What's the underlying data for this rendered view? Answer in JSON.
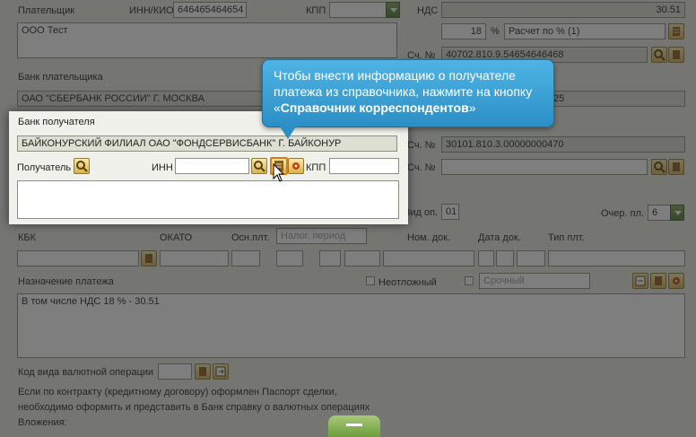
{
  "payer": {
    "label": "Плательщик",
    "inn_label": "ИНН/КИО",
    "inn_value": "646465464654",
    "kpp_label": "КПП",
    "kpp_value": "",
    "name_value": "ООО Тест",
    "bank_label": "Банк плательщика",
    "bank_value": "ОАО \"СБЕРБАНК РОССИИ\" Г. МОСКВА",
    "account_label": "Сч. №",
    "account_value": "40702.810.9.54654646468"
  },
  "vat": {
    "label": "НДС",
    "value": "30.51",
    "rate": "18",
    "percent_sign": "%",
    "calc_value": "Расчет по % (1)"
  },
  "recipient": {
    "bank_label": "Банк получателя",
    "bank_value": "БАЙКОНУРСКИЙ ФИЛИАЛ ОАО \"ФОНДСЕРВИСБАНК\" Г. БАЙКОНУР",
    "label": "Получатель",
    "inn_label": "ИНН",
    "inn_value": "",
    "kpp_label": "КПП",
    "kpp_value": "",
    "name_value": "",
    "corr_label": "Сч. №",
    "corr_value": "30101.810.3.00000000470",
    "account_label": "Сч. №",
    "account_value": "",
    "hidden_suffix": "25"
  },
  "operation": {
    "vid_label": "Вид оп.",
    "vid_value": "01",
    "queue_label": "Очер. пл.",
    "queue_value": "6"
  },
  "tax": {
    "kbk_label": "КБК",
    "okato_label": "ОКАТО",
    "osn_label": "Осн.плт.",
    "period_placeholder": "Налог. период",
    "nom_label": "Ном. док.",
    "date_label": "Дата док.",
    "type_label": "Тип плт."
  },
  "purpose": {
    "label": "Назначение платежа",
    "urgent_label": "Неотложный",
    "urgent_field": "Срочный",
    "text": "В том числе НДС 18 % - 30.51"
  },
  "currency": {
    "label": "Код вида валютной операции",
    "note_line1": "Если по контракту (кредитному договору) оформлен Паспорт сделки,",
    "note_line2": "необходимо оформить и представить в Банк справку о валютных операциях",
    "attachments_label": "Вложения:"
  },
  "tooltip": {
    "text": "Чтобы внести информацию о получателе платежа из справочника, нажмите на кнопку «",
    "bold": "Справочник корреспондентов",
    "tail": "»"
  },
  "colors": {
    "accent_button": "#d8b34a",
    "tooltip": "#2b8fc6",
    "dropdown": "#4d7a2f"
  }
}
